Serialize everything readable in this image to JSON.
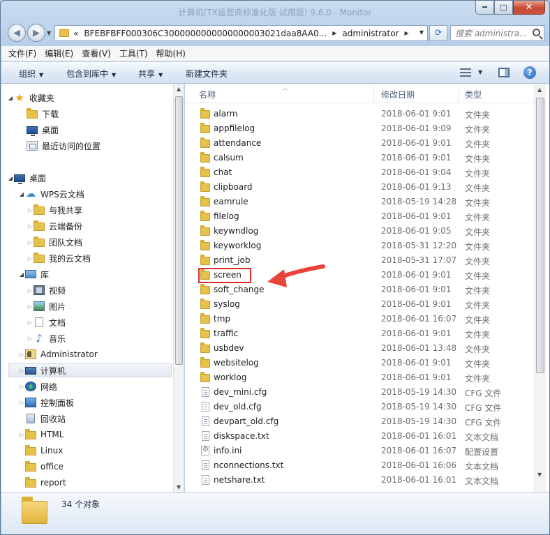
{
  "window": {
    "title": "计算机(TX运营商标准化版 试用版) 9.6.0 - Monitor",
    "buttons": {
      "minimize": "━",
      "maximize": "□",
      "close": "✕"
    }
  },
  "address": {
    "overflow": "«",
    "segments": [
      "BFEBFBFF000306C3000000000000000003021daa8AA0...",
      "administrator"
    ],
    "search_placeholder": "搜索 administra..."
  },
  "menu": [
    "文件(F)",
    "编辑(E)",
    "查看(V)",
    "工具(T)",
    "帮助(H)"
  ],
  "toolbar": {
    "organize": "组织",
    "include_in_library": "包含到库中",
    "share": "共享",
    "new_folder": "新建文件夹"
  },
  "nav": {
    "favorites": "收藏夹",
    "downloads": "下载",
    "desktop_fav": "桌面",
    "recent": "最近访问的位置",
    "desktop": "桌面",
    "wps": "WPS云文档",
    "shared_with_me": "与我共享",
    "cloud_backup": "云端备份",
    "team_docs": "团队文档",
    "my_cloud": "我的云文档",
    "library": "库",
    "videos": "视频",
    "pictures": "图片",
    "documents": "文档",
    "music": "音乐",
    "administrator": "Administrator",
    "computer": "计算机",
    "network": "网络",
    "control_panel": "控制面板",
    "recycle_bin": "回收站",
    "html": "HTML",
    "linux": "Linux",
    "office": "office",
    "report": "report"
  },
  "columns": {
    "name": "名称",
    "modified": "修改日期",
    "type": "类型"
  },
  "files": [
    {
      "name": "alarm",
      "date": "2018-06-01 9:01",
      "type": "文件夹",
      "kind": "folder"
    },
    {
      "name": "appfilelog",
      "date": "2018-06-01 9:09",
      "type": "文件夹",
      "kind": "folder"
    },
    {
      "name": "attendance",
      "date": "2018-06-01 9:01",
      "type": "文件夹",
      "kind": "folder"
    },
    {
      "name": "calsum",
      "date": "2018-06-01 9:01",
      "type": "文件夹",
      "kind": "folder"
    },
    {
      "name": "chat",
      "date": "2018-06-01 9:04",
      "type": "文件夹",
      "kind": "folder"
    },
    {
      "name": "clipboard",
      "date": "2018-06-01 9:13",
      "type": "文件夹",
      "kind": "folder"
    },
    {
      "name": "eamrule",
      "date": "2018-05-19 14:28",
      "type": "文件夹",
      "kind": "folder"
    },
    {
      "name": "filelog",
      "date": "2018-06-01 9:01",
      "type": "文件夹",
      "kind": "folder"
    },
    {
      "name": "keywndlog",
      "date": "2018-06-01 9:05",
      "type": "文件夹",
      "kind": "folder"
    },
    {
      "name": "keyworklog",
      "date": "2018-05-31 12:20",
      "type": "文件夹",
      "kind": "folder"
    },
    {
      "name": "print_job",
      "date": "2018-05-31 17:07",
      "type": "文件夹",
      "kind": "folder"
    },
    {
      "name": "screen",
      "date": "2018-06-01 9:01",
      "type": "文件夹",
      "kind": "folder"
    },
    {
      "name": "soft_change",
      "date": "2018-06-01 9:01",
      "type": "文件夹",
      "kind": "folder"
    },
    {
      "name": "syslog",
      "date": "2018-06-01 9:01",
      "type": "文件夹",
      "kind": "folder"
    },
    {
      "name": "tmp",
      "date": "2018-06-01 16:07",
      "type": "文件夹",
      "kind": "folder"
    },
    {
      "name": "traffic",
      "date": "2018-06-01 9:01",
      "type": "文件夹",
      "kind": "folder"
    },
    {
      "name": "usbdev",
      "date": "2018-06-01 13:48",
      "type": "文件夹",
      "kind": "folder"
    },
    {
      "name": "websitelog",
      "date": "2018-06-01 9:01",
      "type": "文件夹",
      "kind": "folder"
    },
    {
      "name": "worklog",
      "date": "2018-06-01 9:01",
      "type": "文件夹",
      "kind": "folder"
    },
    {
      "name": "dev_mini.cfg",
      "date": "2018-05-19 14:30",
      "type": "CFG 文件",
      "kind": "file"
    },
    {
      "name": "dev_old.cfg",
      "date": "2018-05-19 14:30",
      "type": "CFG 文件",
      "kind": "file"
    },
    {
      "name": "devpart_old.cfg",
      "date": "2018-05-19 14:30",
      "type": "CFG 文件",
      "kind": "file"
    },
    {
      "name": "diskspace.txt",
      "date": "2018-06-01 16:01",
      "type": "文本文档",
      "kind": "file"
    },
    {
      "name": "info.ini",
      "date": "2018-06-01 16:07",
      "type": "配置设置",
      "kind": "ini"
    },
    {
      "name": "nconnections.txt",
      "date": "2018-06-01 16:06",
      "type": "文本文档",
      "kind": "file"
    },
    {
      "name": "netshare.txt",
      "date": "2018-06-01 16:01",
      "type": "文本文档",
      "kind": "file"
    }
  ],
  "annotation": {
    "highlighted": "screen",
    "color": "#e02a2a",
    "arrow_color": "#e8443a"
  },
  "status": {
    "count": "34 个对象"
  }
}
